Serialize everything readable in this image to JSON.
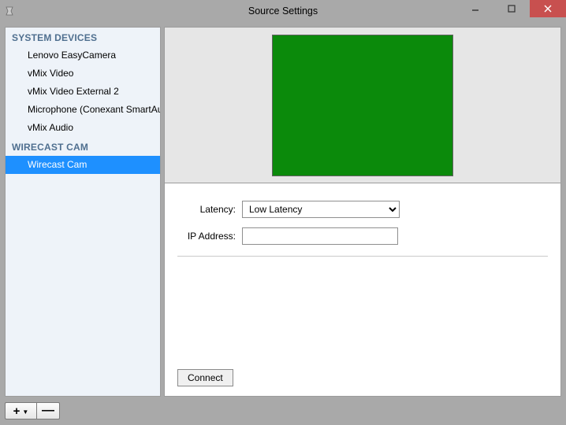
{
  "window": {
    "title": "Source Settings"
  },
  "sidebar": {
    "groups": [
      {
        "header": "SYSTEM DEVICES",
        "items": [
          {
            "label": "Lenovo EasyCamera",
            "selected": false
          },
          {
            "label": "vMix Video",
            "selected": false
          },
          {
            "label": "vMix Video External 2",
            "selected": false
          },
          {
            "label": "Microphone (Conexant SmartAudio",
            "selected": false
          },
          {
            "label": "vMix Audio",
            "selected": false
          }
        ]
      },
      {
        "header": "WIRECAST CAM",
        "items": [
          {
            "label": "Wirecast Cam",
            "selected": true
          }
        ]
      }
    ]
  },
  "settings": {
    "latency_label": "Latency:",
    "latency_value": "Low Latency",
    "ip_label": "IP Address:",
    "ip_value": "",
    "connect_label": "Connect"
  }
}
